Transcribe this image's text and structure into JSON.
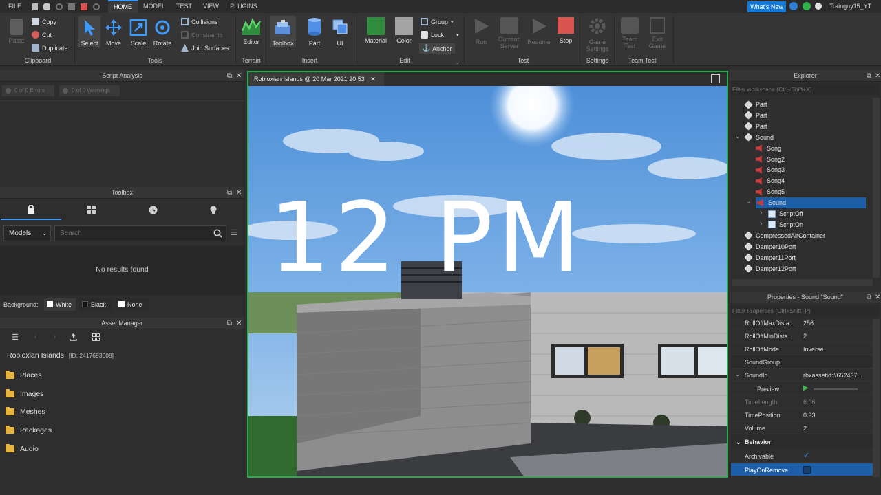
{
  "menubar": {
    "file": "FILE",
    "tabs": [
      "HOME",
      "MODEL",
      "TEST",
      "VIEW",
      "PLUGINS"
    ],
    "whats_new": "What's New",
    "username": "Trainguy15_YT"
  },
  "ribbon": {
    "clipboard": {
      "group": "Clipboard",
      "paste": "Paste",
      "copy": "Copy",
      "cut": "Cut",
      "duplicate": "Duplicate"
    },
    "tools": {
      "group": "Tools",
      "select": "Select",
      "move": "Move",
      "scale": "Scale",
      "rotate": "Rotate",
      "collisions": "Collisions",
      "constraints": "Constraints",
      "join_surfaces": "Join Surfaces"
    },
    "terrain": {
      "group": "Terrain",
      "editor": "Editor"
    },
    "insert": {
      "group": "Insert",
      "toolbox": "Toolbox",
      "part": "Part",
      "ui": "UI"
    },
    "edit": {
      "group": "Edit",
      "material": "Material",
      "color": "Color",
      "group_btn": "Group",
      "lock": "Lock",
      "anchor": "Anchor"
    },
    "test": {
      "group": "Test",
      "run": "Run",
      "current_server_1": "Current:",
      "current_server_2": "Server",
      "resume": "Resume",
      "stop": "Stop"
    },
    "settings": {
      "group": "Settings",
      "game_settings_1": "Game",
      "game_settings_2": "Settings"
    },
    "team_test": {
      "group": "Team Test",
      "team_test_1": "Team",
      "team_test_2": "Test",
      "exit_game_1": "Exit",
      "exit_game_2": "Game"
    }
  },
  "script_analysis": {
    "title": "Script Analysis",
    "errors": "0 of 0 Errors",
    "warnings": "0 of 0 Warnings"
  },
  "toolbox": {
    "title": "Toolbox",
    "category": "Models",
    "search_placeholder": "Search",
    "empty": "No results found",
    "background_label": "Background:",
    "bg_options": [
      "White",
      "Black",
      "None"
    ]
  },
  "asset_manager": {
    "title": "Asset Manager",
    "place_name": "Robloxian Islands",
    "place_id": "[ID: 2417693608]",
    "folders": [
      "Places",
      "Images",
      "Meshes",
      "Packages",
      "Audio"
    ]
  },
  "viewport": {
    "tab_title": "Robloxian Islands @ 20 Mar 2021 20:53",
    "overlay_text": "12 PM"
  },
  "explorer": {
    "title": "Explorer",
    "filter_placeholder": "Filter workspace (Ctrl+Shift+X)",
    "items": [
      {
        "label": "Part",
        "indent": 0
      },
      {
        "label": "Part",
        "indent": 0
      },
      {
        "label": "Part",
        "indent": 0
      },
      {
        "label": "Sound",
        "indent": 0
      },
      {
        "label": "Song",
        "indent": 1
      },
      {
        "label": "Song2",
        "indent": 1
      },
      {
        "label": "Song3",
        "indent": 1
      },
      {
        "label": "Song4",
        "indent": 1
      },
      {
        "label": "Song5",
        "indent": 1
      },
      {
        "label": "Sound",
        "indent": 1
      },
      {
        "label": "ScriptOff",
        "indent": 2
      },
      {
        "label": "ScriptOn",
        "indent": 2
      },
      {
        "label": "CompressedAirContainer",
        "indent": 0
      },
      {
        "label": "Damper10Port",
        "indent": 0
      },
      {
        "label": "Damper11Port",
        "indent": 0
      },
      {
        "label": "Damper12Port",
        "indent": 0
      }
    ]
  },
  "properties": {
    "title": "Properties - Sound \"Sound\"",
    "filter_placeholder": "Filter Properties (Ctrl+Shift+P)",
    "rows": [
      {
        "name": "RollOffMaxDista...",
        "value": "256"
      },
      {
        "name": "RollOffMinDista...",
        "value": "2"
      },
      {
        "name": "RollOffMode",
        "value": "Inverse"
      },
      {
        "name": "SoundGroup",
        "value": ""
      },
      {
        "name": "SoundId",
        "value": "rbxassetid://652437..."
      },
      {
        "name": "Preview",
        "value": ""
      },
      {
        "name": "TimeLength",
        "value": "6.06"
      },
      {
        "name": "TimePosition",
        "value": "0.93"
      },
      {
        "name": "Volume",
        "value": "2"
      }
    ],
    "section_behavior": "Behavior",
    "archivable": "Archivable",
    "play_on_remove": "PlayOnRemove"
  },
  "colors": {
    "accent": "#3d9bff",
    "viewport_border": "#2ea84f",
    "selection": "#1d5ea8",
    "stop_red": "#d9534f",
    "material_green": "#2f8c3c"
  }
}
